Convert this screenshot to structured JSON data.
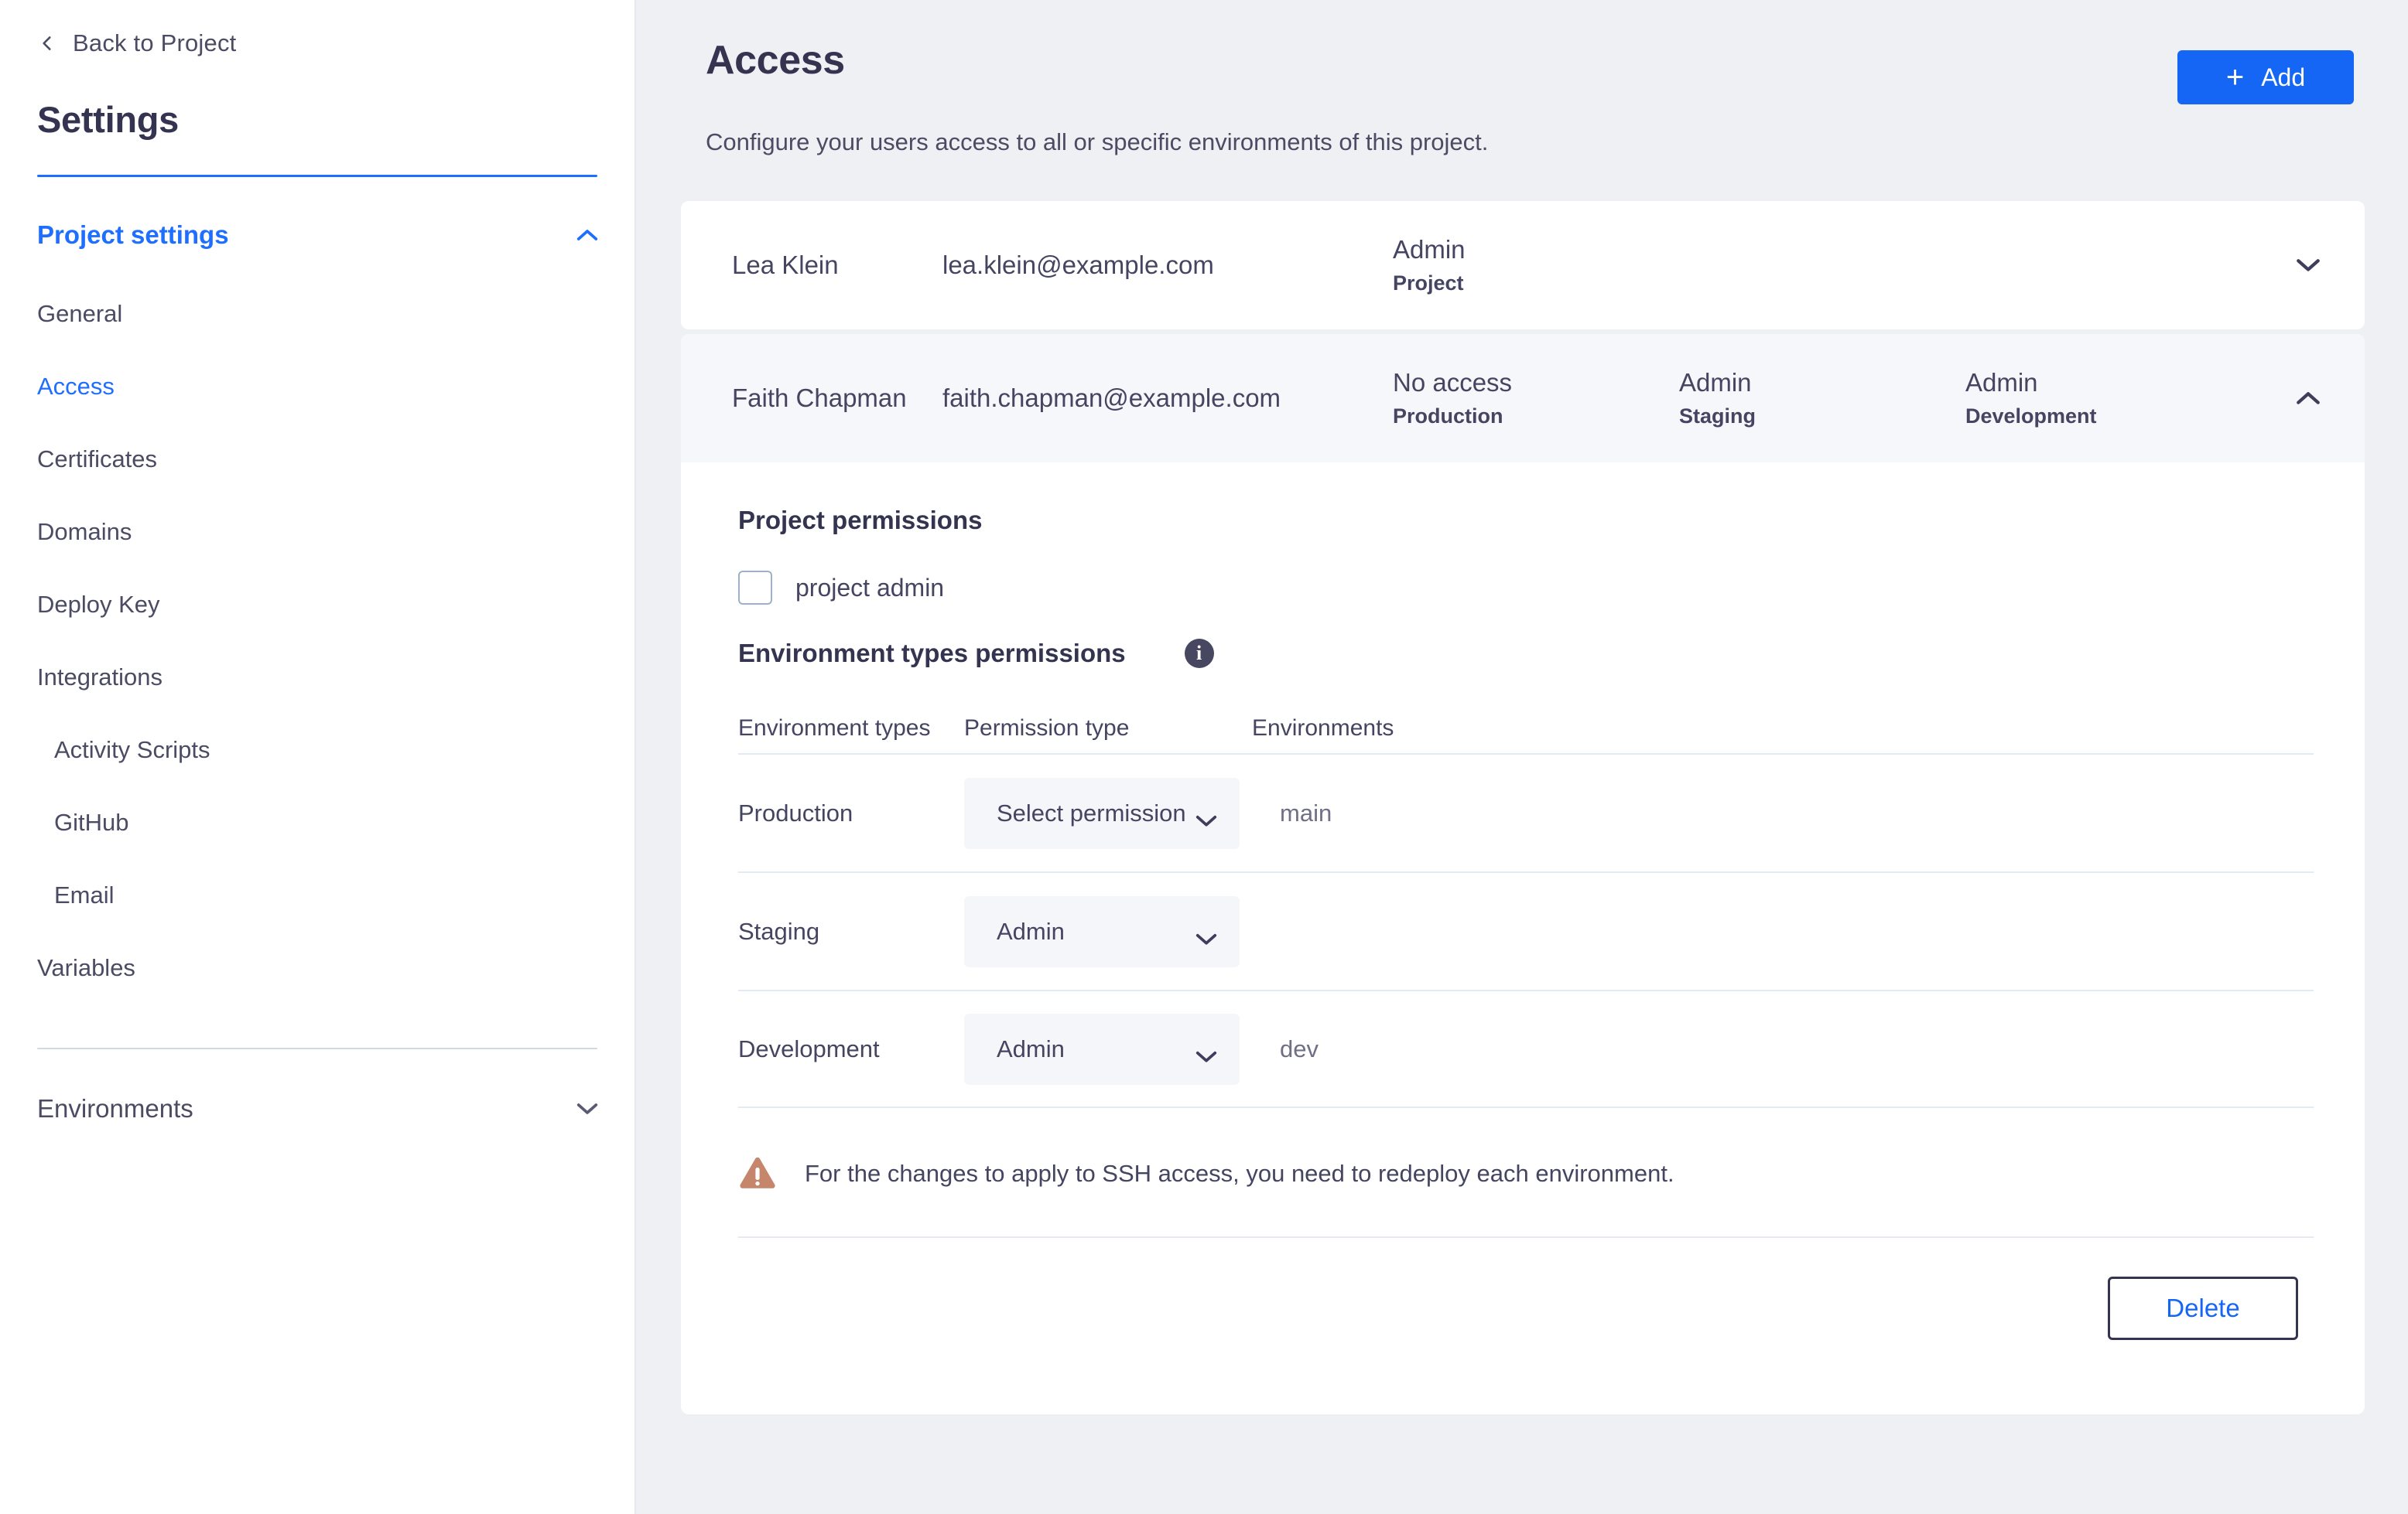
{
  "sidebar": {
    "back_label": "Back to Project",
    "back_icon": "chevron-left-icon",
    "title": "Settings",
    "project_settings": {
      "label": "Project settings",
      "caret_icon": "chevron-up-icon"
    },
    "items": [
      {
        "label": "General",
        "active": false,
        "sub": false
      },
      {
        "label": "Access",
        "active": true,
        "sub": false
      },
      {
        "label": "Certificates",
        "active": false,
        "sub": false
      },
      {
        "label": "Domains",
        "active": false,
        "sub": false
      },
      {
        "label": "Deploy Key",
        "active": false,
        "sub": false
      },
      {
        "label": "Integrations",
        "active": false,
        "sub": false
      },
      {
        "label": "Activity Scripts",
        "active": false,
        "sub": true
      },
      {
        "label": "GitHub",
        "active": false,
        "sub": true
      },
      {
        "label": "Email",
        "active": false,
        "sub": true
      },
      {
        "label": "Variables",
        "active": false,
        "sub": false
      }
    ],
    "environments": {
      "label": "Environments",
      "caret_icon": "chevron-down-icon"
    }
  },
  "main": {
    "title": "Access",
    "subtitle": "Configure your users access to all or specific environments of this project.",
    "add_button": {
      "label": "Add",
      "plus": "+",
      "icon": "plus-icon",
      "color": "#1666f5"
    }
  },
  "users": [
    {
      "name": "Lea Klein",
      "email": "lea.klein@example.com",
      "expanded": false,
      "caret_icon": "chevron-down-icon",
      "permissions": [
        {
          "type": "Admin",
          "scope": "Project"
        }
      ]
    },
    {
      "name": "Faith Chapman",
      "email": "faith.chapman@example.com",
      "expanded": true,
      "caret_icon": "chevron-up-icon",
      "permissions": [
        {
          "type": "No access",
          "scope": "Production"
        },
        {
          "type": "Admin",
          "scope": "Staging"
        },
        {
          "type": "Admin",
          "scope": "Development"
        }
      ]
    }
  ],
  "detail": {
    "project_permissions_title": "Project permissions",
    "project_admin_label": "project admin",
    "project_admin_checked": false,
    "env_permissions_title": "Environment types permissions",
    "info_icon": "info-icon",
    "info_glyph": "i",
    "table": {
      "columns": [
        "Environment types",
        "Permission type",
        "Environments"
      ],
      "rows": [
        {
          "env_type": "Production",
          "permission": "Select permission",
          "environments": "main",
          "caret_icon": "chevron-down-icon"
        },
        {
          "env_type": "Staging",
          "permission": "Admin",
          "environments": "",
          "caret_icon": "chevron-down-icon"
        },
        {
          "env_type": "Development",
          "permission": "Admin",
          "environments": "dev",
          "caret_icon": "chevron-down-icon"
        }
      ]
    },
    "warning": {
      "icon": "warning-triangle-icon",
      "color": "#c5866c",
      "text": "For the changes to apply to SSH access, you need to redeploy each environment."
    },
    "delete_button": {
      "label": "Delete",
      "color": "#1666f5"
    }
  }
}
